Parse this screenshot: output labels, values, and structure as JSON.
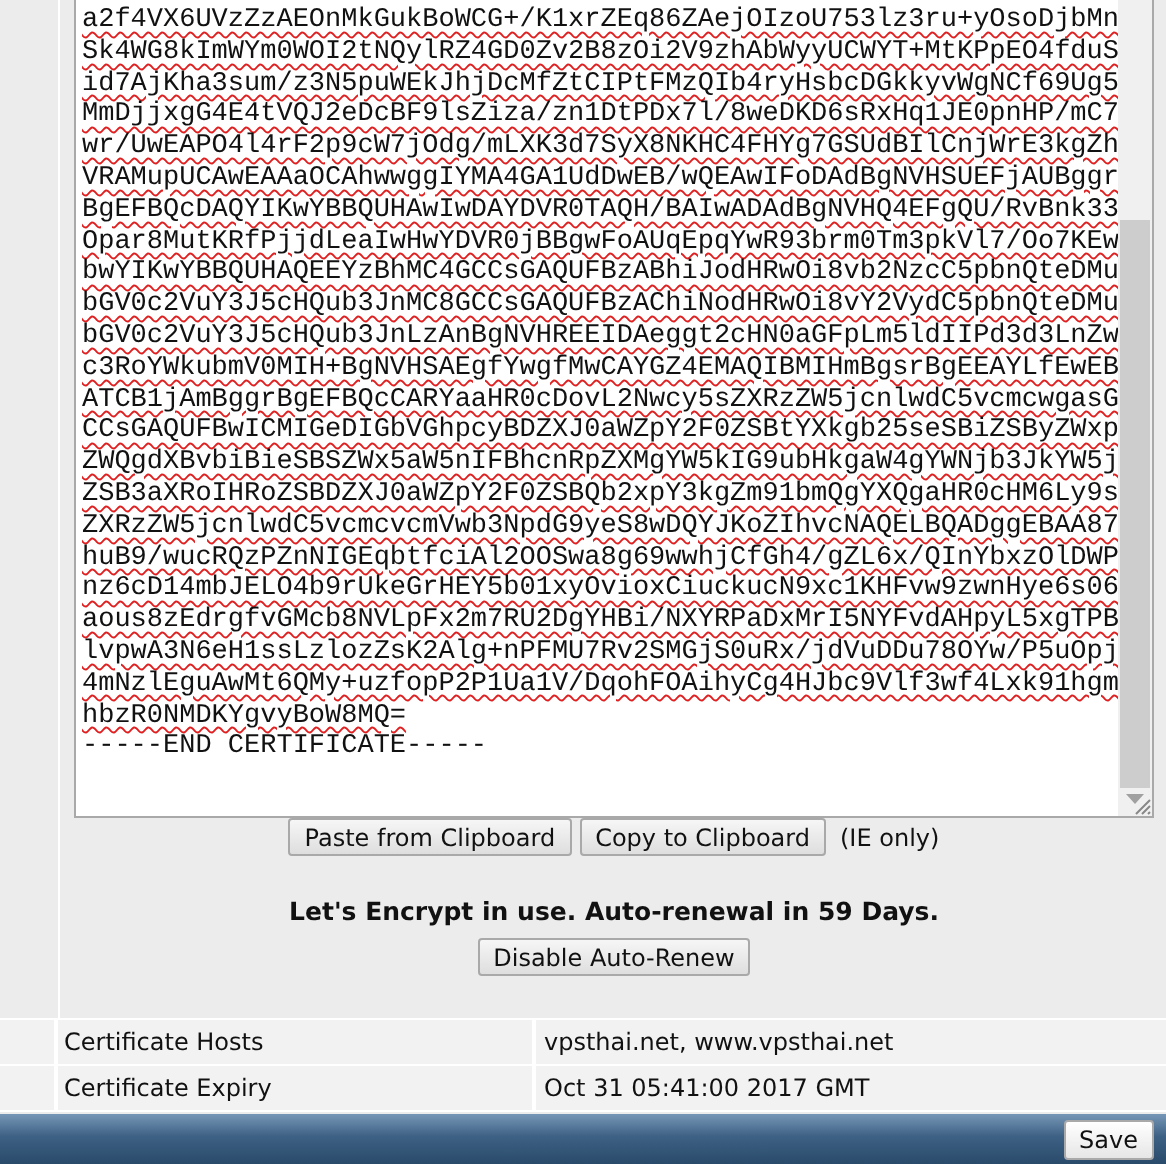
{
  "certificate": {
    "lines": [
      "a2f4VX6UVzZzAEOnMkGukBoWCG+/K1xrZEq86ZAejOIzoU753lz3ru+yOsoDjbMn",
      "Sk4WG8kImWYm0WOI2tNQylRZ4GD0Zv2B8zOi2V9zhAbWyyUCWYT+MtKPpEO4fduS",
      "id7AjKha3sum/z3N5puWEkJhjDcMfZtCIPtFMzQIb4ryHsbcDGkkyvWgNCf69Ug5",
      "MmDjjxgG4E4tVQJ2eDcBF9lsZiza/zn1DtPDx7l/8weDKD6sRxHq1JE0pnHP/mC7",
      "wr/UwEAPO4l4rF2p9cW7jOdg/mLXK3d7SyX8NKHC4FHYg7GSUdBIlCnjWrE3kgZh",
      "VRAMupUCAwEAAaOCAhwwggIYMA4GA1UdDwEB/wQEAwIFoDAdBgNVHSUEFjAUBggr",
      "BgEFBQcDAQYIKwYBBQUHAwIwDAYDVR0TAQH/BAIwADAdBgNVHQ4EFgQU/RvBnk33",
      "Opar8MutKRfPjjdLeaIwHwYDVR0jBBgwFoAUqEpqYwR93brm0Tm3pkVl7/Oo7KEw",
      "bwYIKwYBBQUHAQEEYzBhMC4GCCsGAQUFBzABhiJodHRwOi8vb2NzcC5pbnQteDMu",
      "bGV0c2VuY3J5cHQub3JnMC8GCCsGAQUFBzAChiNodHRwOi8vY2VydC5pbnQteDMu",
      "bGV0c2VuY3J5cHQub3JnLzAnBgNVHREEIDAeggt2cHN0aGFpLm5ldIIPd3d3LnZw",
      "c3RoYWkubmV0MIH+BgNVHSAEgfYwgfMwCAYGZ4EMAQIBMIHmBgsrBgEEAYLfEwEB",
      "ATCB1jAmBggrBgEFBQcCARYaaHR0cDovL2Nwcy5sZXRzZW5jcnlwdC5vcmcwgasG",
      "CCsGAQUFBwICMIGeDIGbVGhpcyBDZXJ0aWZpY2F0ZSBtYXkgb25seSBiZSByZWxp",
      "ZWQgdXBvbiBieSBSZWx5aW5nIFBhcnRpZXMgYW5kIG9ubHkgaW4gYWNjb3JkYW5j",
      "ZSB3aXRoIHRoZSBDZXJ0aWZpY2F0ZSBQb2xpY3kgZm91bmQgYXQgaHR0cHM6Ly9s",
      "ZXRzZW5jcnlwdC5vcmcvcmVwb3NpdG9yeS8wDQYJKoZIhvcNAQELBQADggEBAA87",
      "huB9/wucRQzPZnNIGEqbtfciAl2OOSwa8g69wwhjCfGh4/gZL6x/QInYbxzOlDWP",
      "nz6cD14mbJELO4b9rUkeGrHEY5b01xyOvioxCiuckucN9xc1KHFvw9zwnHye6s06",
      "aous8zEdrgfvGMcb8NVLpFx2m7RU2DgYHBi/NXYRPaDxMrI5NYFvdAHpyL5xgTPB",
      "lvpwA3N6eH1ssLzlozZsK2Alg+nPFMU7Rv2SMGjS0uRx/jdVuDDu78OYw/P5uOpj",
      "4mNzlEguAwMt6QMy+uzfopP2P1Ua1V/DqohFOAihyCg4HJbc9Vlf3wf4Lxk91hgm",
      "hbzR0NMDKYgvyBoW8MQ="
    ],
    "end_marker": "-----END CERTIFICATE-----",
    "paste_button": "Paste from Clipboard",
    "copy_button": "Copy to Clipboard",
    "clipboard_note": "(IE only)",
    "status": "Let's Encrypt in use. Auto-renewal in 59 Days.",
    "disable_button": "Disable Auto-Renew"
  },
  "details": [
    {
      "label": "Certificate Hosts",
      "value": "vpsthai.net, www.vpsthai.net"
    },
    {
      "label": "Certificate Expiry",
      "value": "Oct 31 05:41:00 2017 GMT"
    }
  ],
  "footer": {
    "save_button": "Save"
  }
}
